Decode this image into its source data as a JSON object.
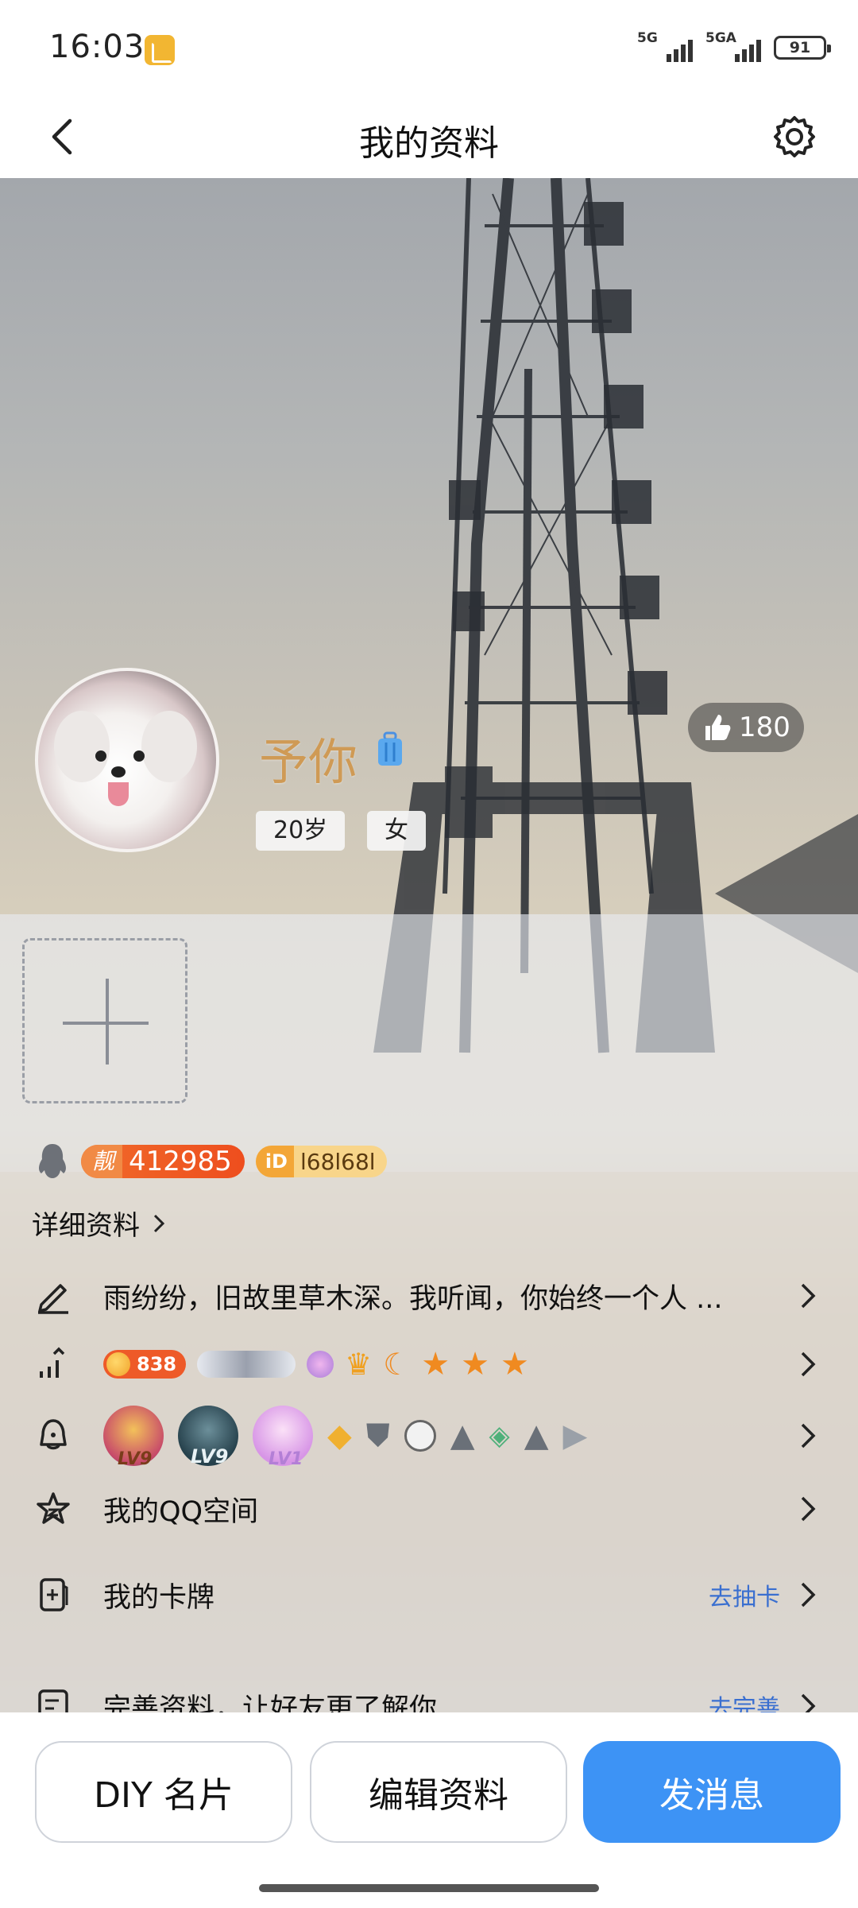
{
  "status_bar": {
    "time": "16:03",
    "network1": "5G",
    "network2": "5GA",
    "battery": "91"
  },
  "nav": {
    "title": "我的资料"
  },
  "profile": {
    "nickname": "予你",
    "age_tag": "20岁",
    "gender_tag": "女",
    "likes": "180",
    "pretty_number_prefix": "靓",
    "pretty_number": "412985",
    "id_prefix": "iD",
    "id_value": "l68l68l"
  },
  "detail_link": {
    "label": "详细资料"
  },
  "rows": {
    "signature": {
      "text": "雨纷纷，旧故里草木深。我听闻，你始终一个人 ...",
      "icon": "pen-icon"
    },
    "levels": {
      "icon": "rank-icon",
      "coin_value": "838"
    },
    "badges": {
      "icon": "bell-icon",
      "items": [
        {
          "label": "LV9"
        },
        {
          "label": "LV9"
        },
        {
          "label": "LV1"
        }
      ]
    },
    "qzone": {
      "text": "我的QQ空间",
      "icon": "star-icon"
    },
    "cards": {
      "text": "我的卡牌",
      "action": "去抽卡",
      "icon": "card-icon"
    },
    "complete": {
      "text": "完善资料，让好友更了解你",
      "action": "去完善",
      "icon": "doc-icon"
    }
  },
  "bottom": {
    "diy_label": "DIY 名片",
    "edit_label": "编辑资料",
    "message_label": "发消息"
  },
  "colors": {
    "primary": "#3d93f5",
    "nickname": "#cf9a55",
    "link": "#3a6fd0",
    "badge_orange": "#ee4e1e"
  }
}
